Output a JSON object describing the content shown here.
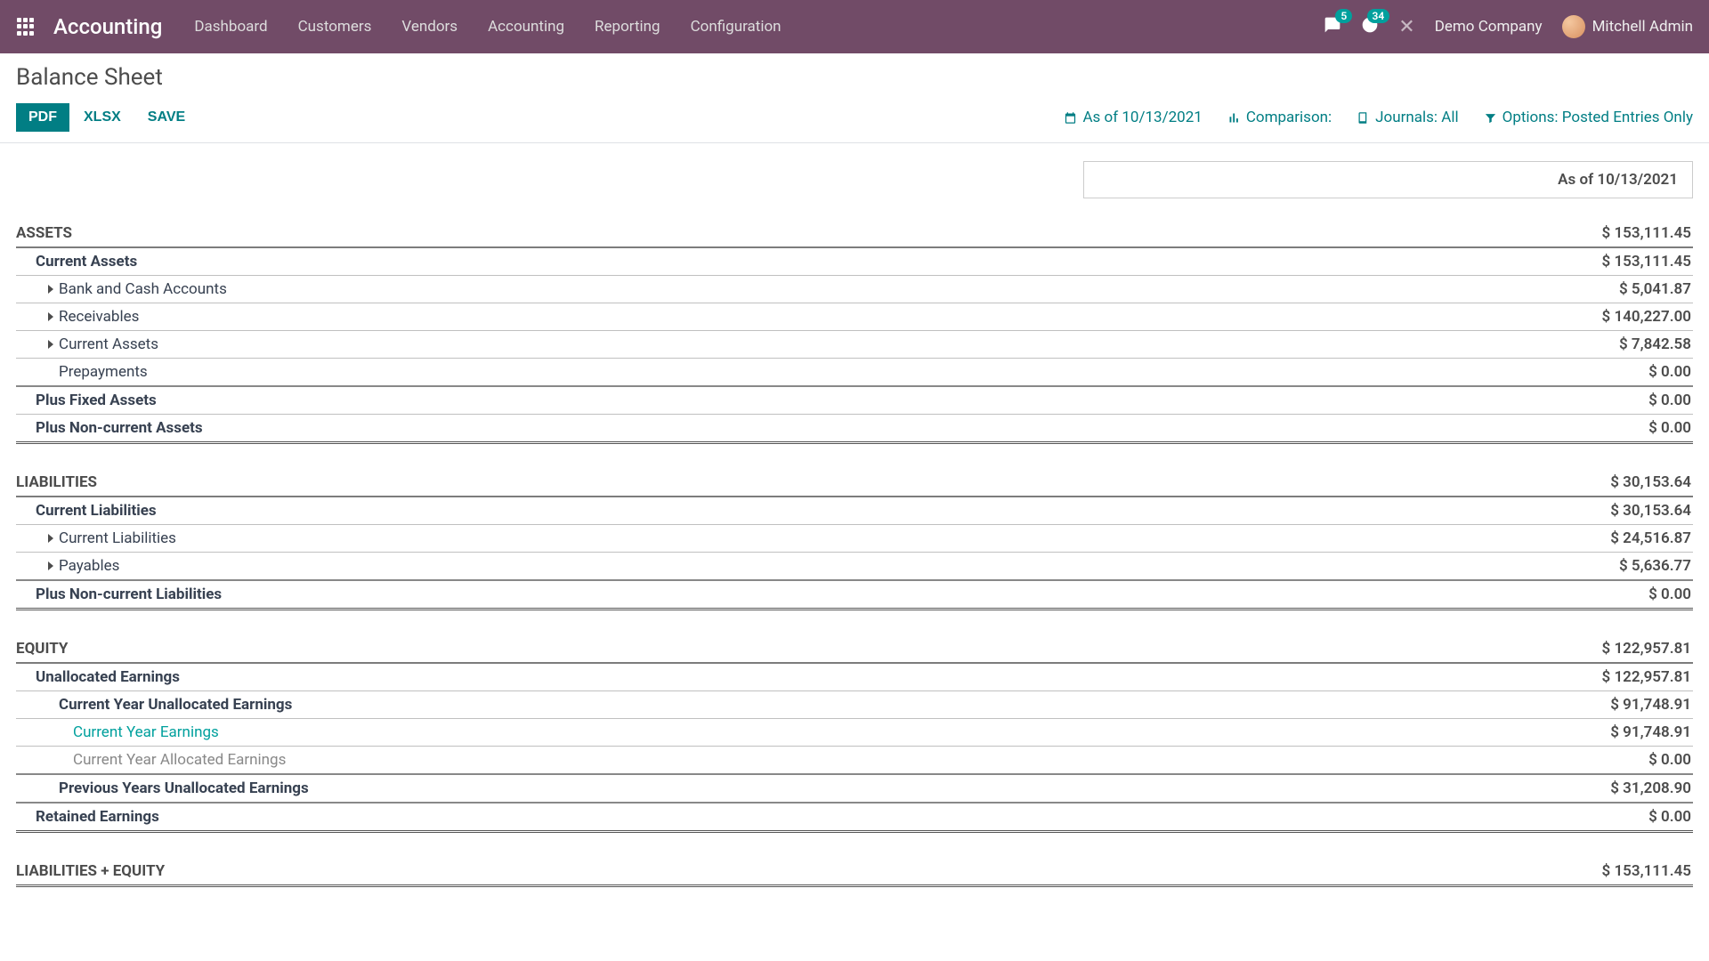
{
  "navbar": {
    "brand": "Accounting",
    "menu": [
      "Dashboard",
      "Customers",
      "Vendors",
      "Accounting",
      "Reporting",
      "Configuration"
    ],
    "messages_badge": "5",
    "activities_badge": "34",
    "company": "Demo Company",
    "user": "Mitchell Admin"
  },
  "page": {
    "title": "Balance Sheet"
  },
  "toolbar": {
    "buttons": {
      "pdf": "PDF",
      "xlsx": "XLSX",
      "save": "SAVE"
    },
    "filters": {
      "as_of": "As of 10/13/2021",
      "comparison": "Comparison:",
      "journals": "Journals: All",
      "options": "Options: Posted Entries Only"
    }
  },
  "date_header": "As of 10/13/2021",
  "rows": [
    {
      "label": "ASSETS",
      "value": "$ 153,111.45",
      "type": "section"
    },
    {
      "label": "Current Assets",
      "value": "$ 153,111.45",
      "indent": 1,
      "bold": true,
      "rule": "sep"
    },
    {
      "label": "Bank and Cash Accounts",
      "value": "$ 5,041.87",
      "indent": 2,
      "caret": true,
      "rule": "sep"
    },
    {
      "label": "Receivables",
      "value": "$ 140,227.00",
      "indent": 2,
      "caret": true,
      "rule": "sep"
    },
    {
      "label": "Current Assets",
      "value": "$ 7,842.58",
      "indent": 2,
      "caret": true,
      "rule": "sep"
    },
    {
      "label": "Prepayments",
      "value": "$ 0.00",
      "indent": 2,
      "rule": "thick"
    },
    {
      "label": "Plus Fixed Assets",
      "value": "$ 0.00",
      "indent": 1,
      "bold": true,
      "rule": "sep"
    },
    {
      "label": "Plus Non-current Assets",
      "value": "$ 0.00",
      "indent": 1,
      "bold": true,
      "rule": "double"
    },
    {
      "gap": true
    },
    {
      "label": "LIABILITIES",
      "value": "$ 30,153.64",
      "type": "section"
    },
    {
      "label": "Current Liabilities",
      "value": "$ 30,153.64",
      "indent": 1,
      "bold": true,
      "rule": "sep"
    },
    {
      "label": "Current Liabilities",
      "value": "$ 24,516.87",
      "indent": 2,
      "caret": true,
      "rule": "sep"
    },
    {
      "label": "Payables",
      "value": "$ 5,636.77",
      "indent": 2,
      "caret": true,
      "rule": "thick"
    },
    {
      "label": "Plus Non-current Liabilities",
      "value": "$ 0.00",
      "indent": 1,
      "bold": true,
      "rule": "double"
    },
    {
      "gap": true
    },
    {
      "label": "EQUITY",
      "value": "$ 122,957.81",
      "type": "section"
    },
    {
      "label": "Unallocated Earnings",
      "value": "$ 122,957.81",
      "indent": 1,
      "bold": true,
      "rule": "sep"
    },
    {
      "label": "Current Year Unallocated Earnings",
      "value": "$ 91,748.91",
      "indent": 2,
      "bold": true,
      "rule": "sep"
    },
    {
      "label": "Current Year Earnings",
      "value": "$ 91,748.91",
      "indent": 3,
      "link": true,
      "rule": "sep"
    },
    {
      "label": "Current Year Allocated Earnings",
      "value": "$ 0.00",
      "indent": 3,
      "muted": true,
      "rule": "thick"
    },
    {
      "label": "Previous Years Unallocated Earnings",
      "value": "$ 31,208.90",
      "indent": 2,
      "bold": true,
      "rule": "thick"
    },
    {
      "label": "Retained Earnings",
      "value": "$ 0.00",
      "indent": 1,
      "bold": true,
      "rule": "double"
    },
    {
      "gap": true
    },
    {
      "label": "LIABILITIES + EQUITY",
      "value": "$ 153,111.45",
      "type": "section",
      "rule": "double"
    }
  ]
}
